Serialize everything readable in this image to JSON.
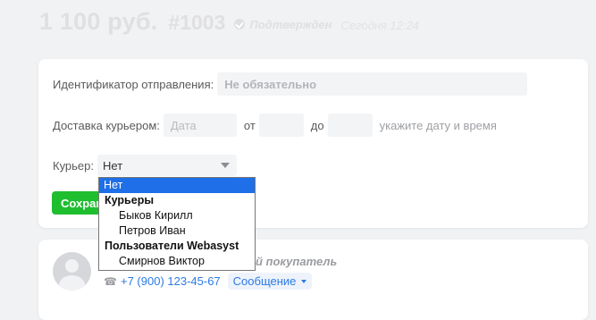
{
  "header": {
    "amount": "1 100 руб.",
    "order_number": "#1003",
    "status": "Подтвержден",
    "time": "Сегодня 12:24"
  },
  "form": {
    "tracking_label": "Идентификатор отправления:",
    "tracking_placeholder": "Не обязательно",
    "courier_delivery_label": "Доставка курьером:",
    "date_placeholder": "Дата",
    "from_label": "от",
    "to_label": "до",
    "hint": "укажите дату и время",
    "courier_label": "Курьер:",
    "courier_value": "Нет",
    "save_label": "Сохранить"
  },
  "dropdown": {
    "selected": "Нет",
    "group1": "Курьеры",
    "group1_items": [
      "Быков Кирилл",
      "Петров Иван"
    ],
    "group2": "Пользователи Webasyst",
    "group2_items": [
      "Смирнов Виктор"
    ]
  },
  "customer": {
    "buyer_label": "й покупатель",
    "phone": "+7 (900) 123-45-67",
    "message_button": "Сообщение"
  },
  "icons": {
    "status": "check-circle-icon",
    "phone": "phone-icon",
    "avatar": "user-avatar-icon"
  },
  "colors": {
    "save_button": "#1fbe2f",
    "selected_option": "#1e6fe8",
    "link": "#2c7be5"
  }
}
